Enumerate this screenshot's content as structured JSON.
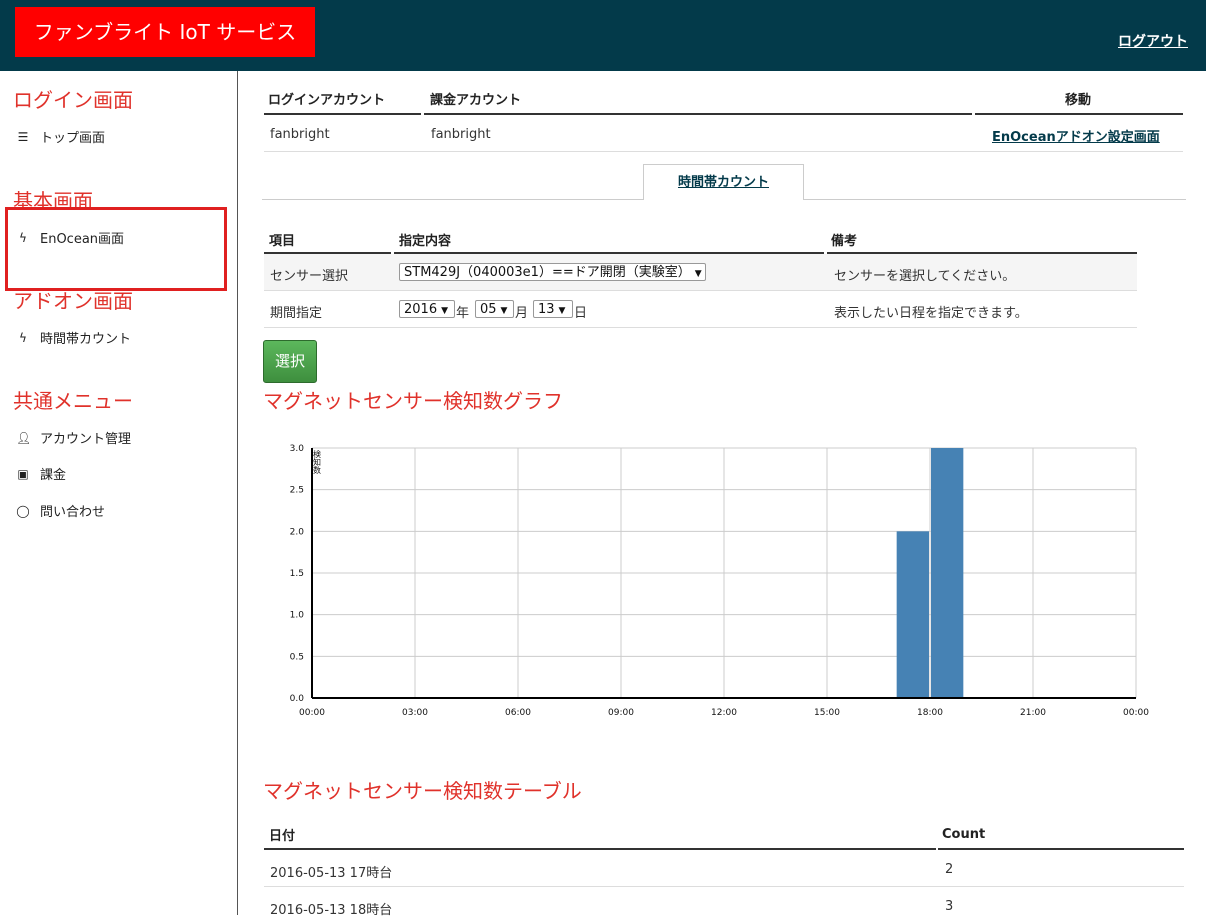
{
  "header": {
    "brand": "ファンブライト IoT サービス",
    "logout": "ログアウト"
  },
  "sidebar": {
    "sections": [
      {
        "title": "ログイン画面",
        "items": [
          {
            "label": "トップ画面",
            "icon": "menu-icon"
          }
        ]
      },
      {
        "title": "基本画面",
        "items": [
          {
            "label": "EnOcean画面",
            "icon": "bolt-icon"
          }
        ]
      },
      {
        "title": "アドオン画面",
        "items": [
          {
            "label": "時間帯カウント",
            "icon": "bolt-icon"
          }
        ]
      },
      {
        "title": "共通メニュー",
        "items": [
          {
            "label": "アカウント管理",
            "icon": "user-icon"
          },
          {
            "label": "課金",
            "icon": "money-icon"
          },
          {
            "label": "問い合わせ",
            "icon": "comment-icon"
          }
        ]
      }
    ]
  },
  "account": {
    "headers": [
      "ログインアカウント",
      "課金アカウント",
      "移動"
    ],
    "login_account": "fanbright",
    "billing_account": "fanbright",
    "move_link": "EnOceanアドオン設定画面"
  },
  "tab": {
    "label": "時間帯カウント"
  },
  "conditions": {
    "headers": [
      "項目",
      "指定内容",
      "備考"
    ],
    "sensor_label": "センサー選択",
    "sensor_value": "STM429J（040003e1）==ドア開閉（実験室）",
    "sensor_note": "センサーを選択してください。",
    "period_label": "期間指定",
    "year": "2016",
    "year_unit": "年",
    "month": "05",
    "month_unit": "月",
    "day": "13",
    "day_unit": "日",
    "period_note": "表示したい日程を指定できます。",
    "select_button": "選択"
  },
  "graph_title": "マグネットセンサー検知数グラフ",
  "chart_data": {
    "type": "bar",
    "ylabel": "検知数",
    "ylim": [
      0,
      3
    ],
    "yticks": [
      "0.0",
      "0.5",
      "1.0",
      "1.5",
      "2.0",
      "2.5",
      "3.0"
    ],
    "xlim": [
      0,
      24
    ],
    "xticks": [
      "00:00",
      "03:00",
      "06:00",
      "09:00",
      "12:00",
      "15:00",
      "18:00",
      "21:00",
      "00:00"
    ],
    "bars": [
      {
        "hour": 17,
        "value": 2
      },
      {
        "hour": 18,
        "value": 3
      }
    ],
    "grid": true,
    "color": "#4682b4"
  },
  "table_title": "マグネットセンサー検知数テーブル",
  "count_table": {
    "headers": [
      "日付",
      "Count"
    ],
    "rows": [
      {
        "date": "2016-05-13 17時台",
        "count": "2"
      },
      {
        "date": "2016-05-13 18時台",
        "count": "3"
      }
    ]
  }
}
